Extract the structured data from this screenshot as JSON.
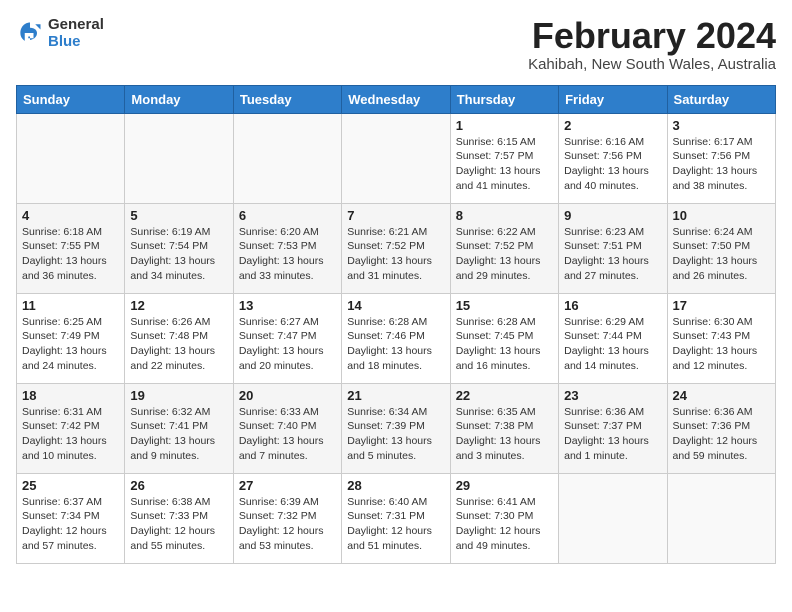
{
  "header": {
    "logo_general": "General",
    "logo_blue": "Blue",
    "month_year": "February 2024",
    "location": "Kahibah, New South Wales, Australia"
  },
  "weekdays": [
    "Sunday",
    "Monday",
    "Tuesday",
    "Wednesday",
    "Thursday",
    "Friday",
    "Saturday"
  ],
  "weeks": [
    [
      {
        "day": "",
        "info": ""
      },
      {
        "day": "",
        "info": ""
      },
      {
        "day": "",
        "info": ""
      },
      {
        "day": "",
        "info": ""
      },
      {
        "day": "1",
        "info": "Sunrise: 6:15 AM\nSunset: 7:57 PM\nDaylight: 13 hours and 41 minutes."
      },
      {
        "day": "2",
        "info": "Sunrise: 6:16 AM\nSunset: 7:56 PM\nDaylight: 13 hours and 40 minutes."
      },
      {
        "day": "3",
        "info": "Sunrise: 6:17 AM\nSunset: 7:56 PM\nDaylight: 13 hours and 38 minutes."
      }
    ],
    [
      {
        "day": "4",
        "info": "Sunrise: 6:18 AM\nSunset: 7:55 PM\nDaylight: 13 hours and 36 minutes."
      },
      {
        "day": "5",
        "info": "Sunrise: 6:19 AM\nSunset: 7:54 PM\nDaylight: 13 hours and 34 minutes."
      },
      {
        "day": "6",
        "info": "Sunrise: 6:20 AM\nSunset: 7:53 PM\nDaylight: 13 hours and 33 minutes."
      },
      {
        "day": "7",
        "info": "Sunrise: 6:21 AM\nSunset: 7:52 PM\nDaylight: 13 hours and 31 minutes."
      },
      {
        "day": "8",
        "info": "Sunrise: 6:22 AM\nSunset: 7:52 PM\nDaylight: 13 hours and 29 minutes."
      },
      {
        "day": "9",
        "info": "Sunrise: 6:23 AM\nSunset: 7:51 PM\nDaylight: 13 hours and 27 minutes."
      },
      {
        "day": "10",
        "info": "Sunrise: 6:24 AM\nSunset: 7:50 PM\nDaylight: 13 hours and 26 minutes."
      }
    ],
    [
      {
        "day": "11",
        "info": "Sunrise: 6:25 AM\nSunset: 7:49 PM\nDaylight: 13 hours and 24 minutes."
      },
      {
        "day": "12",
        "info": "Sunrise: 6:26 AM\nSunset: 7:48 PM\nDaylight: 13 hours and 22 minutes."
      },
      {
        "day": "13",
        "info": "Sunrise: 6:27 AM\nSunset: 7:47 PM\nDaylight: 13 hours and 20 minutes."
      },
      {
        "day": "14",
        "info": "Sunrise: 6:28 AM\nSunset: 7:46 PM\nDaylight: 13 hours and 18 minutes."
      },
      {
        "day": "15",
        "info": "Sunrise: 6:28 AM\nSunset: 7:45 PM\nDaylight: 13 hours and 16 minutes."
      },
      {
        "day": "16",
        "info": "Sunrise: 6:29 AM\nSunset: 7:44 PM\nDaylight: 13 hours and 14 minutes."
      },
      {
        "day": "17",
        "info": "Sunrise: 6:30 AM\nSunset: 7:43 PM\nDaylight: 13 hours and 12 minutes."
      }
    ],
    [
      {
        "day": "18",
        "info": "Sunrise: 6:31 AM\nSunset: 7:42 PM\nDaylight: 13 hours and 10 minutes."
      },
      {
        "day": "19",
        "info": "Sunrise: 6:32 AM\nSunset: 7:41 PM\nDaylight: 13 hours and 9 minutes."
      },
      {
        "day": "20",
        "info": "Sunrise: 6:33 AM\nSunset: 7:40 PM\nDaylight: 13 hours and 7 minutes."
      },
      {
        "day": "21",
        "info": "Sunrise: 6:34 AM\nSunset: 7:39 PM\nDaylight: 13 hours and 5 minutes."
      },
      {
        "day": "22",
        "info": "Sunrise: 6:35 AM\nSunset: 7:38 PM\nDaylight: 13 hours and 3 minutes."
      },
      {
        "day": "23",
        "info": "Sunrise: 6:36 AM\nSunset: 7:37 PM\nDaylight: 13 hours and 1 minute."
      },
      {
        "day": "24",
        "info": "Sunrise: 6:36 AM\nSunset: 7:36 PM\nDaylight: 12 hours and 59 minutes."
      }
    ],
    [
      {
        "day": "25",
        "info": "Sunrise: 6:37 AM\nSunset: 7:34 PM\nDaylight: 12 hours and 57 minutes."
      },
      {
        "day": "26",
        "info": "Sunrise: 6:38 AM\nSunset: 7:33 PM\nDaylight: 12 hours and 55 minutes."
      },
      {
        "day": "27",
        "info": "Sunrise: 6:39 AM\nSunset: 7:32 PM\nDaylight: 12 hours and 53 minutes."
      },
      {
        "day": "28",
        "info": "Sunrise: 6:40 AM\nSunset: 7:31 PM\nDaylight: 12 hours and 51 minutes."
      },
      {
        "day": "29",
        "info": "Sunrise: 6:41 AM\nSunset: 7:30 PM\nDaylight: 12 hours and 49 minutes."
      },
      {
        "day": "",
        "info": ""
      },
      {
        "day": "",
        "info": ""
      }
    ]
  ]
}
